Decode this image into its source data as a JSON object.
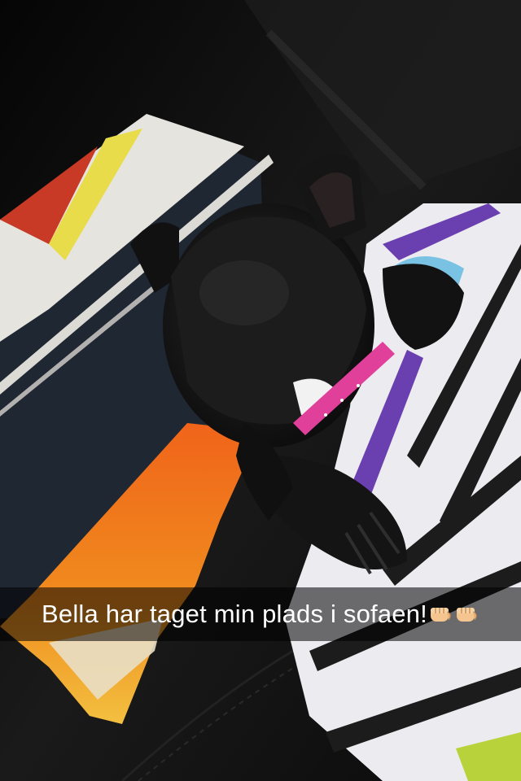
{
  "snap": {
    "caption": "Bella har taget min plads i sofaen!",
    "caption_emojis": [
      "fist-bump-emoji",
      "fist-bump-emoji"
    ]
  },
  "colors": {
    "sofa_leather": "#0d0d0d",
    "pillow_navy": "#1f2733",
    "pillow_white": "#e6e4df",
    "orange_fabric": "#f07a18",
    "collar_pink": "#e0409a",
    "purple_stripe": "#6a3fb0",
    "caption_overlay": "rgba(0,0,0,0.55)"
  }
}
